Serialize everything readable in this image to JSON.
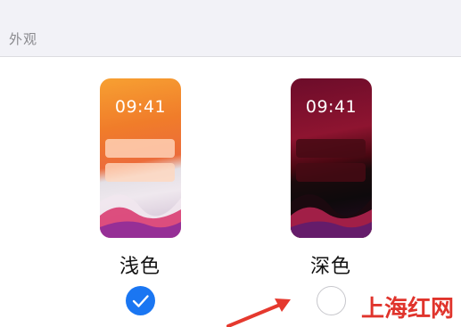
{
  "section": {
    "title": "外观"
  },
  "appearance_options": [
    {
      "label": "浅色",
      "preview_time": "09:41",
      "selected": true
    },
    {
      "label": "深色",
      "preview_time": "09:41",
      "selected": false
    }
  ],
  "colors": {
    "accent": "#1a76f2",
    "arrow": "#e5392e",
    "watermark": "#e0342c"
  },
  "icons": {
    "selected": "checkmark-icon",
    "arrow": "red-arrow-icon"
  },
  "watermark": "上海红网"
}
